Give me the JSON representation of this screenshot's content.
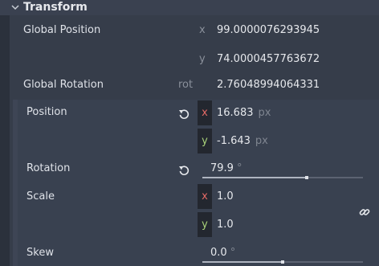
{
  "section": {
    "title": "Transform"
  },
  "global_position": {
    "label": "Global Position",
    "x_axis": "x",
    "x_value": "99.0000076293945",
    "y_axis": "y",
    "y_value": "74.0000457763672"
  },
  "global_rotation": {
    "label": "Global Rotation",
    "axis": "rot",
    "value": "2.76048994064331"
  },
  "position": {
    "label": "Position",
    "x_axis": "x",
    "x_value": "16.683",
    "x_unit": "px",
    "y_axis": "y",
    "y_value": "-1.643",
    "y_unit": "px"
  },
  "rotation": {
    "label": "Rotation",
    "value": "79.9",
    "unit": "°",
    "slider_fraction": 0.65
  },
  "scale": {
    "label": "Scale",
    "x_axis": "x",
    "x_value": "1.0",
    "y_axis": "y",
    "y_value": "1.0"
  },
  "skew": {
    "label": "Skew",
    "value": "0.0",
    "unit": "°",
    "slider_fraction": 0.5
  },
  "icons": {
    "collapse": "chevron-down-icon",
    "revert": "revert-icon",
    "link": "link-icon"
  },
  "colors": {
    "axis_x": "#e36a66",
    "axis_y": "#a9d27a"
  }
}
